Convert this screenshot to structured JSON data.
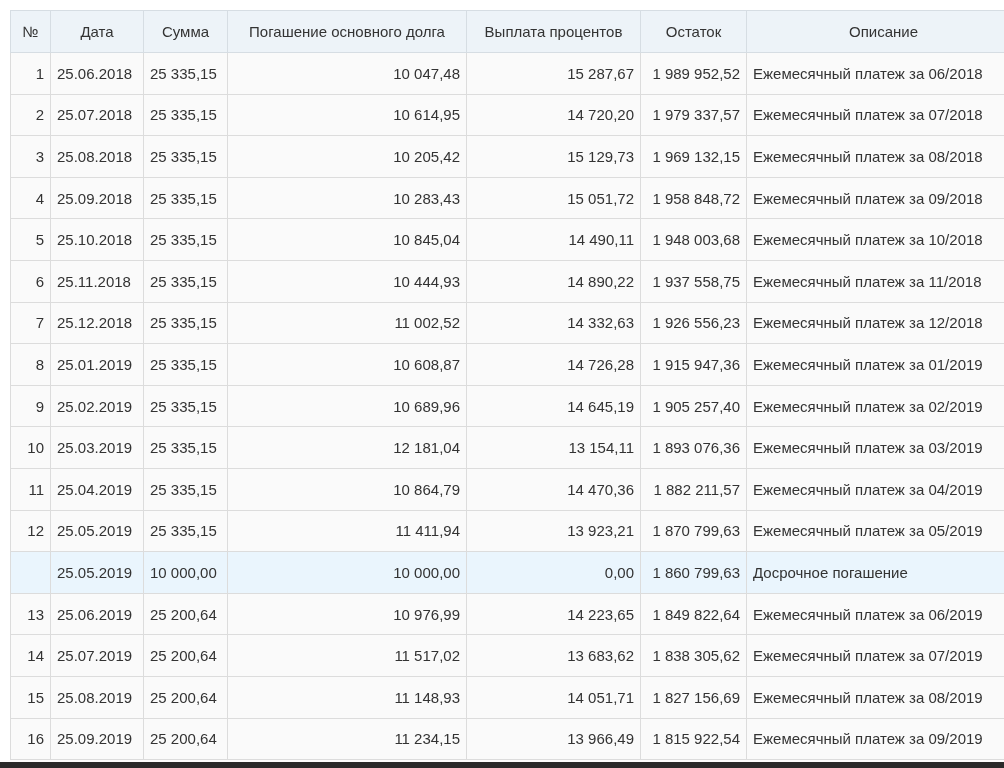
{
  "table": {
    "columns": [
      "№",
      "Дата",
      "Сумма",
      "Погашение основного долга",
      "Выплата процентов",
      "Остаток",
      "Описание"
    ],
    "rows": [
      {
        "kind": "payment",
        "cells": [
          "1",
          "25.06.2018",
          "25 335,15",
          "10 047,48",
          "15 287,67",
          "1 989 952,52",
          "Ежемесячный платеж за 06/2018"
        ]
      },
      {
        "kind": "payment",
        "cells": [
          "2",
          "25.07.2018",
          "25 335,15",
          "10 614,95",
          "14 720,20",
          "1 979 337,57",
          "Ежемесячный платеж за 07/2018"
        ]
      },
      {
        "kind": "payment",
        "cells": [
          "3",
          "25.08.2018",
          "25 335,15",
          "10 205,42",
          "15 129,73",
          "1 969 132,15",
          "Ежемесячный платеж за 08/2018"
        ]
      },
      {
        "kind": "payment",
        "cells": [
          "4",
          "25.09.2018",
          "25 335,15",
          "10 283,43",
          "15 051,72",
          "1 958 848,72",
          "Ежемесячный платеж за 09/2018"
        ]
      },
      {
        "kind": "payment",
        "cells": [
          "5",
          "25.10.2018",
          "25 335,15",
          "10 845,04",
          "14 490,11",
          "1 948 003,68",
          "Ежемесячный платеж за 10/2018"
        ]
      },
      {
        "kind": "payment",
        "cells": [
          "6",
          "25.11.2018",
          "25 335,15",
          "10 444,93",
          "14 890,22",
          "1 937 558,75",
          "Ежемесячный платеж за 11/2018"
        ]
      },
      {
        "kind": "payment",
        "cells": [
          "7",
          "25.12.2018",
          "25 335,15",
          "11 002,52",
          "14 332,63",
          "1 926 556,23",
          "Ежемесячный платеж за 12/2018"
        ]
      },
      {
        "kind": "payment",
        "cells": [
          "8",
          "25.01.2019",
          "25 335,15",
          "10 608,87",
          "14 726,28",
          "1 915 947,36",
          "Ежемесячный платеж за 01/2019"
        ]
      },
      {
        "kind": "payment",
        "cells": [
          "9",
          "25.02.2019",
          "25 335,15",
          "10 689,96",
          "14 645,19",
          "1 905 257,40",
          "Ежемесячный платеж за 02/2019"
        ]
      },
      {
        "kind": "payment",
        "cells": [
          "10",
          "25.03.2019",
          "25 335,15",
          "12 181,04",
          "13 154,11",
          "1 893 076,36",
          "Ежемесячный платеж за 03/2019"
        ]
      },
      {
        "kind": "payment",
        "cells": [
          "11",
          "25.04.2019",
          "25 335,15",
          "10 864,79",
          "14 470,36",
          "1 882 211,57",
          "Ежемесячный платеж за 04/2019"
        ]
      },
      {
        "kind": "payment",
        "cells": [
          "12",
          "25.05.2019",
          "25 335,15",
          "11 411,94",
          "13 923,21",
          "1 870 799,63",
          "Ежемесячный платеж за 05/2019"
        ]
      },
      {
        "kind": "early",
        "cells": [
          "",
          "25.05.2019",
          "10 000,00",
          "10 000,00",
          "0,00",
          "1 860 799,63",
          "Досрочное погашение"
        ]
      },
      {
        "kind": "payment",
        "cells": [
          "13",
          "25.06.2019",
          "25 200,64",
          "10 976,99",
          "14 223,65",
          "1 849 822,64",
          "Ежемесячный платеж за 06/2019"
        ]
      },
      {
        "kind": "payment",
        "cells": [
          "14",
          "25.07.2019",
          "25 200,64",
          "11 517,02",
          "13 683,62",
          "1 838 305,62",
          "Ежемесячный платеж за 07/2019"
        ]
      },
      {
        "kind": "payment",
        "cells": [
          "15",
          "25.08.2019",
          "25 200,64",
          "11 148,93",
          "14 051,71",
          "1 827 156,69",
          "Ежемесячный платеж за 08/2019"
        ]
      },
      {
        "kind": "payment",
        "cells": [
          "16",
          "25.09.2019",
          "25 200,64",
          "11 234,15",
          "13 966,49",
          "1 815 922,54",
          "Ежемесячный платеж за 09/2019"
        ]
      }
    ]
  }
}
